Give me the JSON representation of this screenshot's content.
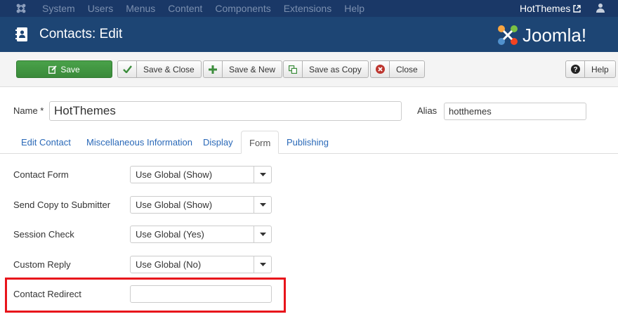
{
  "topnav": {
    "menu": [
      "System",
      "Users",
      "Menus",
      "Content",
      "Components",
      "Extensions",
      "Help"
    ],
    "site_name": "HotThemes"
  },
  "header": {
    "title": "Contacts: Edit",
    "brand": "Joomla!"
  },
  "toolbar": {
    "save": "Save",
    "save_close": "Save & Close",
    "save_new": "Save & New",
    "save_copy": "Save as Copy",
    "close": "Close",
    "help": "Help"
  },
  "form": {
    "name_label": "Name *",
    "name_value": "HotThemes",
    "alias_label": "Alias",
    "alias_value": "hotthemes"
  },
  "tabs": [
    "Edit Contact",
    "Miscellaneous Information",
    "Display",
    "Form",
    "Publishing"
  ],
  "active_tab": "Form",
  "fields": [
    {
      "label": "Contact Form",
      "value": "Use Global (Show)"
    },
    {
      "label": "Send Copy to Submitter",
      "value": "Use Global (Show)"
    },
    {
      "label": "Session Check",
      "value": "Use Global (Yes)"
    },
    {
      "label": "Custom Reply",
      "value": "Use Global (No)"
    }
  ],
  "redirect": {
    "label": "Contact Redirect",
    "value": ""
  },
  "colors": {
    "topnav_bg": "#1a3867",
    "header_bg": "#1d4574",
    "save_green": "#3f953f",
    "link_blue": "#2a69b8",
    "highlight_red": "#e8141b"
  }
}
